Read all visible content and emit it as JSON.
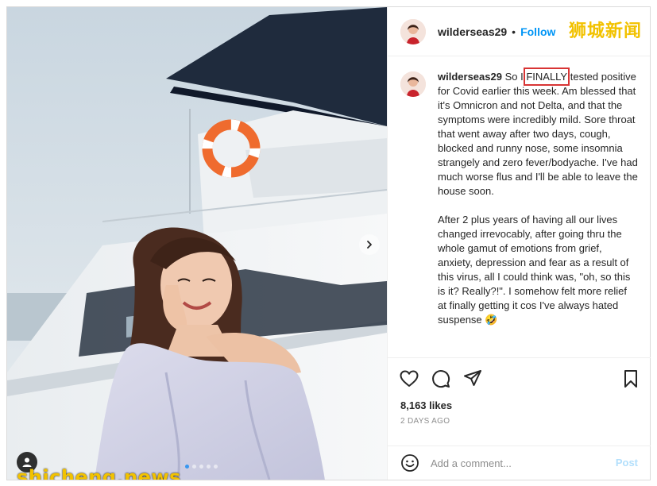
{
  "post": {
    "username": "wilderseas29",
    "follow_label": "Follow",
    "header_separator": "•",
    "likes": "8,163 likes",
    "date": "2 DAYS AGO"
  },
  "caption": {
    "username": "wilderseas29",
    "p1_before": "So I ",
    "p1_highlight": "FINALLY",
    "p1_after": " tested positive for Covid earlier this week. Am blessed that it's Omnicron and not Delta, and that the symptoms were incredibly mild. Sore throat that went away after two days, cough, blocked and runny nose, some insomnia strangely and zero fever/bodyache. I've had much worse flus and I'll be able to leave the house soon.",
    "p2": "After 2 plus years of having all our lives changed irrevocably, after going thru the whole gamut of emotions from grief, anxiety, depression and fear as a result of this virus, all I could think was, \"oh, so this is it? Really?!\". I somehow felt more relief at finally getting it cos I've always hated suspense 🤣"
  },
  "comment_box": {
    "placeholder": "Add a comment...",
    "post_label": "Post"
  },
  "carousel": {
    "total": 5,
    "active": 1
  },
  "watermarks": {
    "top": "狮城新闻",
    "bottom": "shicheng.news"
  },
  "icons": {
    "like": "heart-icon",
    "comment": "comment-icon",
    "share": "paper-plane-icon",
    "save": "bookmark-icon",
    "emoji": "smiley-icon",
    "next": "chevron-right-icon",
    "tag": "user-tag-icon"
  },
  "colors": {
    "follow": "#0095f6",
    "post_disabled": "#b2dffc",
    "highlight_box": "#d83434",
    "watermark": "#f2c200"
  }
}
